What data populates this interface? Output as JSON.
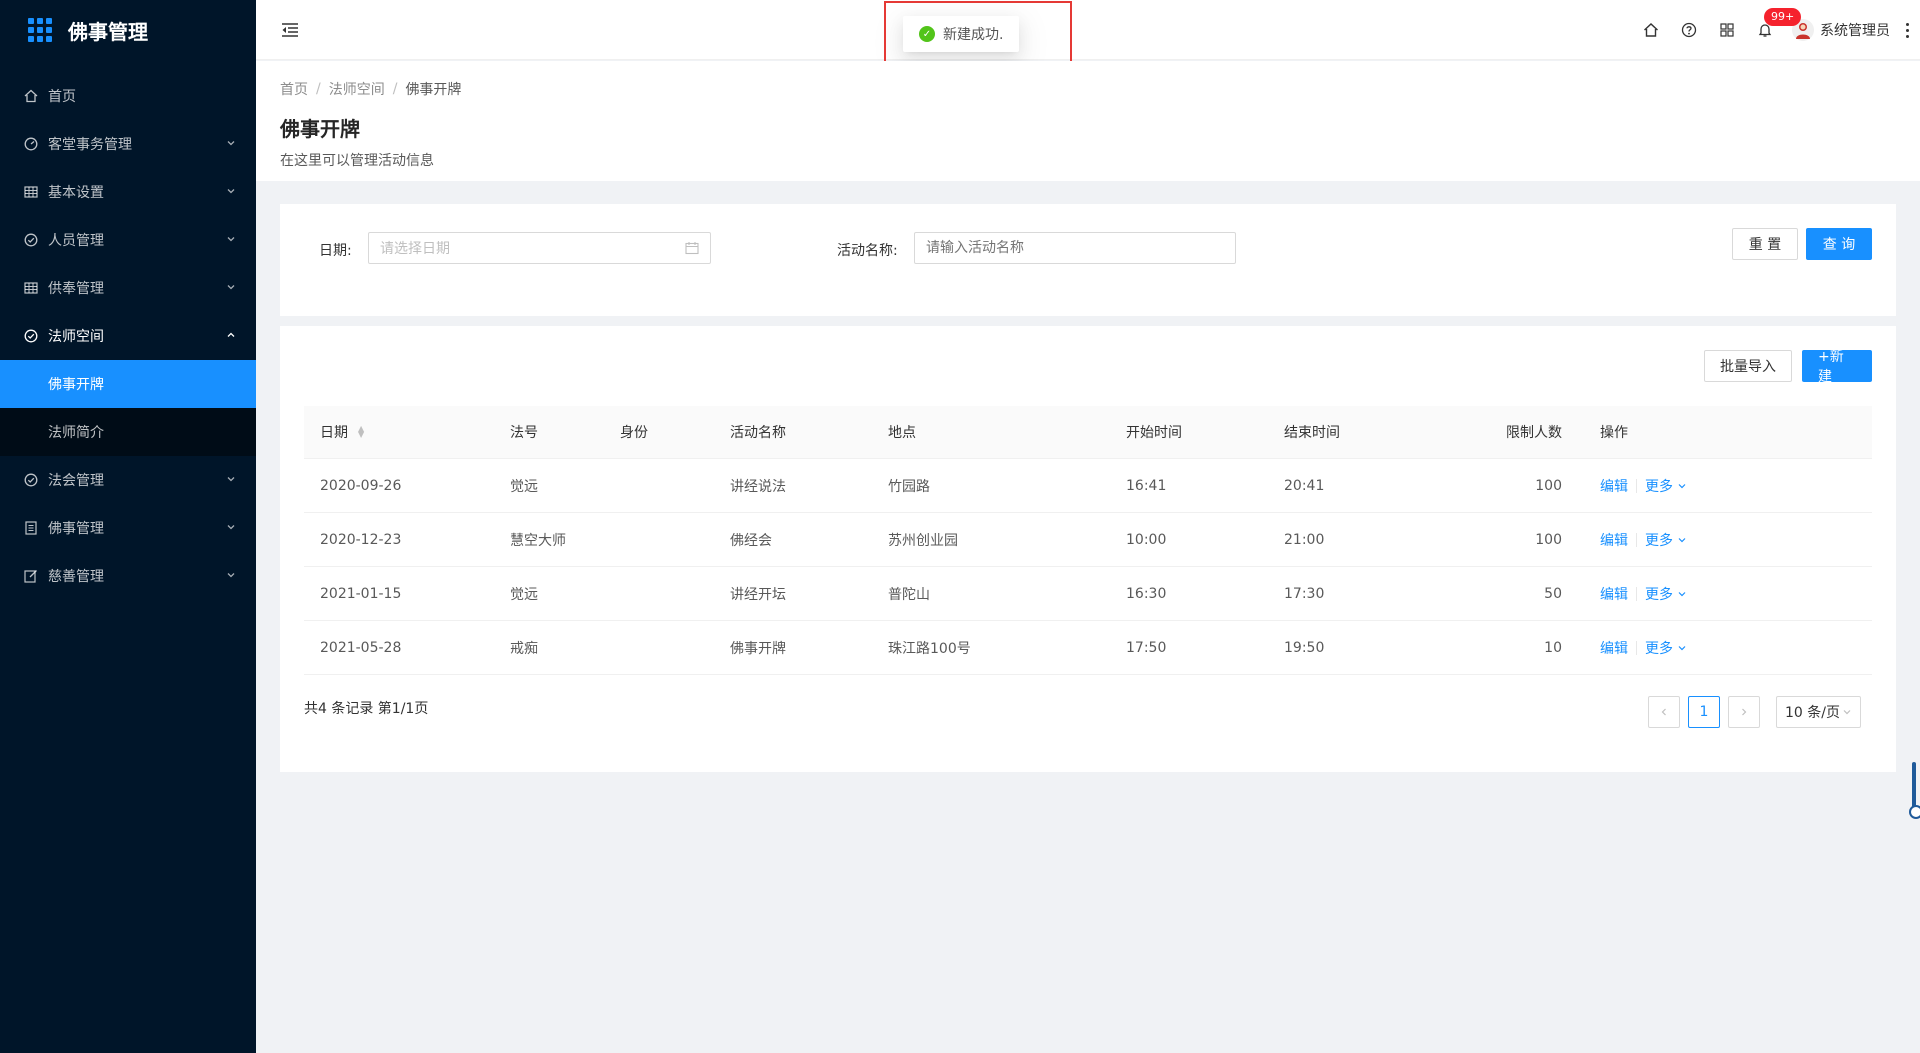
{
  "app": {
    "title": "佛事管理"
  },
  "sidebar": {
    "items": [
      {
        "label": "首页",
        "icon": "home-icon",
        "arrow": ""
      },
      {
        "label": "客堂事务管理",
        "icon": "dashboard-icon",
        "arrow": "⌄"
      },
      {
        "label": "基本设置",
        "icon": "table-icon",
        "arrow": "⌄"
      },
      {
        "label": "人员管理",
        "icon": "check-circle-icon",
        "arrow": "⌄"
      },
      {
        "label": "供奉管理",
        "icon": "table-icon",
        "arrow": "⌄"
      },
      {
        "label": "法师空间",
        "icon": "check-circle-icon",
        "arrow": "⌃"
      },
      {
        "label": "法会管理",
        "icon": "check-circle-icon",
        "arrow": "⌄"
      },
      {
        "label": "佛事管理",
        "icon": "profile-icon",
        "arrow": "⌄"
      },
      {
        "label": "慈善管理",
        "icon": "edit-icon",
        "arrow": "⌄"
      }
    ],
    "submenu": [
      {
        "label": "佛事开牌",
        "active": true
      },
      {
        "label": "法师简介",
        "active": false
      }
    ]
  },
  "header": {
    "badge": "99+",
    "user_name": "系统管理员"
  },
  "toast": {
    "message": "新建成功."
  },
  "breadcrumb": {
    "home": "首页",
    "parent": "法师空间",
    "current": "佛事开牌"
  },
  "page": {
    "title": "佛事开牌",
    "description": "在这里可以管理活动信息"
  },
  "search": {
    "date_label": "日期:",
    "date_placeholder": "请选择日期",
    "name_label": "活动名称:",
    "name_placeholder": "请输入活动名称",
    "reset_label": "重 置",
    "query_label": "查 询"
  },
  "toolbar": {
    "import_label": "批量导入",
    "new_label": "+新建"
  },
  "table": {
    "columns": [
      "日期",
      "法号",
      "身份",
      "活动名称",
      "地点",
      "开始时间",
      "结束时间",
      "限制人数",
      "操作"
    ],
    "rows": [
      {
        "date": "2020-09-26",
        "fahao": "觉远",
        "identity": "",
        "activity": "讲经说法",
        "place": "竹园路",
        "start": "16:41",
        "end": "20:41",
        "limit": "100"
      },
      {
        "date": "2020-12-23",
        "fahao": "慧空大师",
        "identity": "",
        "activity": "佛经会",
        "place": "苏州创业园",
        "start": "10:00",
        "end": "21:00",
        "limit": "100"
      },
      {
        "date": "2021-01-15",
        "fahao": "觉远",
        "identity": "",
        "activity": "讲经开坛",
        "place": "普陀山",
        "start": "16:30",
        "end": "17:30",
        "limit": "50"
      },
      {
        "date": "2021-05-28",
        "fahao": "戒痴",
        "identity": "",
        "activity": "佛事开牌",
        "place": "珠江路100号",
        "start": "17:50",
        "end": "19:50",
        "limit": "10"
      }
    ],
    "action_edit": "编辑",
    "action_more": "更多"
  },
  "pagination": {
    "summary": "共4 条记录 第1/1页",
    "current_page": "1",
    "page_size": "10 条/页"
  },
  "colors": {
    "primary": "#1890ff",
    "sidebar_bg": "#001529",
    "success": "#52c41a",
    "badge": "#f5222d"
  }
}
